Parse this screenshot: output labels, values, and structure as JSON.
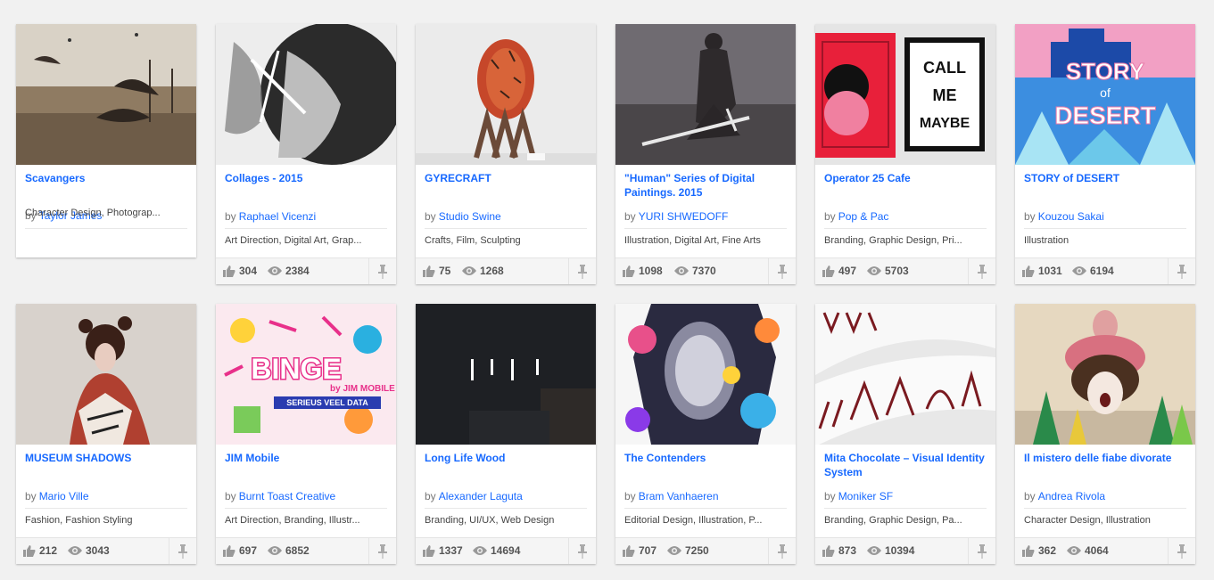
{
  "projects": [
    {
      "title": "Scavangers",
      "by": "by",
      "owner": "Taylor James",
      "fields": "Character Design, Photograp...",
      "likes": "",
      "views": "",
      "colors": [
        "#b8a48a",
        "#8a7560",
        "#d6c9b4"
      ]
    },
    {
      "title": "Collages - 2015",
      "by": "by",
      "owner": "Raphael Vicenzi",
      "fields": "Art Direction, Digital Art, Grap...",
      "likes": "304",
      "views": "2384",
      "colors": [
        "#e9e9e9",
        "#333333",
        "#9a9a9a"
      ]
    },
    {
      "title": "GYRECRAFT",
      "by": "by",
      "owner": "Studio Swine",
      "fields": "Crafts, Film, Sculpting",
      "likes": "75",
      "views": "1268",
      "colors": [
        "#ececec",
        "#c94a2a",
        "#6b4a38"
      ]
    },
    {
      "title": "\"Human\" Series of Digital Paintings. 2015",
      "by": "by",
      "owner": "YURI SHWEDOFF",
      "fields": "Illustration, Digital Art, Fine Arts",
      "likes": "1098",
      "views": "7370",
      "colors": [
        "#6e6a70",
        "#3a3638",
        "#a8a4a8"
      ]
    },
    {
      "title": "Operator 25 Cafe",
      "by": "by",
      "owner": "Pop & Pac",
      "fields": "Branding, Graphic Design, Pri...",
      "likes": "497",
      "views": "5703",
      "colors": [
        "#e9e9e9",
        "#e8203a",
        "#111111"
      ]
    },
    {
      "title": "STORY of DESERT",
      "by": "by",
      "owner": "Kouzou Sakai",
      "fields": "Illustration",
      "likes": "1031",
      "views": "6194",
      "colors": [
        "#4aa0e6",
        "#1c4aa8",
        "#f3b0d0"
      ]
    },
    {
      "title": "MUSEUM SHADOWS",
      "by": "by",
      "owner": "Mario Ville",
      "fields": "Fashion, Fashion Styling",
      "likes": "212",
      "views": "3043",
      "colors": [
        "#d8d2cc",
        "#5a2a20",
        "#c04a30"
      ]
    },
    {
      "title": "JIM Mobile",
      "by": "by",
      "owner": "Burnt Toast Creative",
      "fields": "Art Direction, Branding, Illustr...",
      "likes": "697",
      "views": "6852",
      "colors": [
        "#fbe9ef",
        "#e8308a",
        "#2ab0e0"
      ]
    },
    {
      "title": "Long Life Wood",
      "by": "by",
      "owner": "Alexander Laguta",
      "fields": "Branding, UI/UX, Web Design",
      "likes": "1337",
      "views": "14694",
      "colors": [
        "#1e2024",
        "#2a2c30",
        "#ffffff"
      ]
    },
    {
      "title": "The Contenders",
      "by": "by",
      "owner": "Bram Vanhaeren",
      "fields": "Editorial Design, Illustration, P...",
      "likes": "707",
      "views": "7250",
      "colors": [
        "#f6f6f6",
        "#2a2a40",
        "#e8508a"
      ]
    },
    {
      "title": "Mita Chocolate – Visual Identity System",
      "by": "by",
      "owner": "Moniker SF",
      "fields": "Branding, Graphic Design, Pa...",
      "likes": "873",
      "views": "10394",
      "colors": [
        "#f2f2f2",
        "#7a1a20",
        "#cccccc"
      ]
    },
    {
      "title": "Il mistero delle fiabe divorate",
      "by": "by",
      "owner": "Andrea Rivola",
      "fields": "Character Design, Illustration",
      "likes": "362",
      "views": "4064",
      "colors": [
        "#e6d8c0",
        "#2a8a4a",
        "#e0a0a0"
      ]
    }
  ],
  "thumb_text": {
    "collages": "",
    "operator_line1": "CALL",
    "operator_line2": "ME",
    "operator_line3": "MAYBE",
    "desert_line1": "STORY",
    "desert_line2": "of",
    "desert_line3": "DESERT",
    "binge": "BINGE",
    "binge_sub": "by JIM MOBILE",
    "binge_tag": "SERIEUS VEEL DATA",
    "wood": "I' I' I"
  },
  "icons": {
    "likes": "thumbs-up-icon",
    "views": "eye-icon",
    "pin": "pin-icon"
  }
}
